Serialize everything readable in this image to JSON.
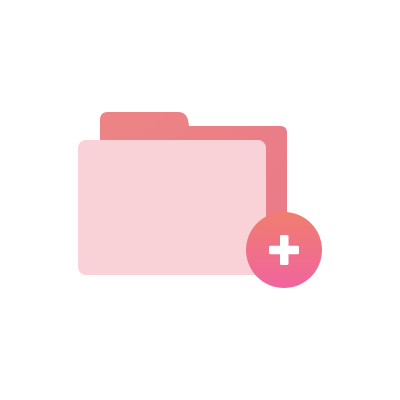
{
  "illustration": {
    "subject": "add-folder",
    "icons": [
      "folder-icon",
      "plus-icon"
    ],
    "colors": {
      "background": "#ffffff",
      "folder_back": "#ec8585",
      "folder_back_right": "#e9788a",
      "folder_front": "#f9d2d8",
      "badge_top": "#f07e6e",
      "badge_bottom": "#f0649f",
      "plus": "#ffffff"
    }
  }
}
